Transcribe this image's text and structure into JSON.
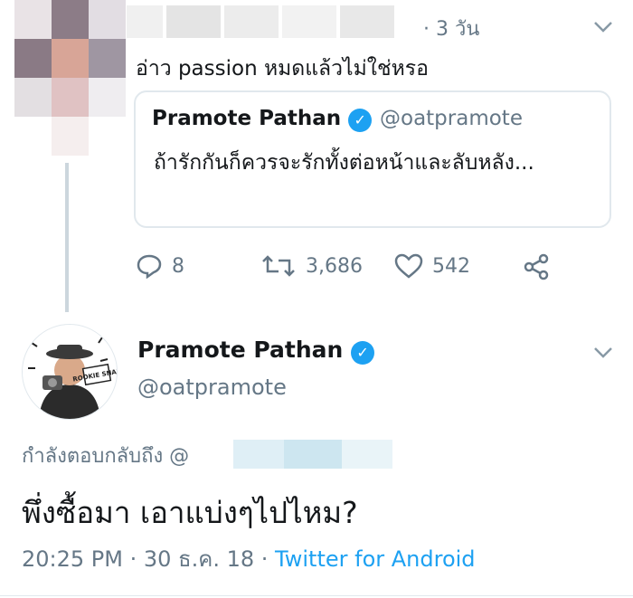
{
  "reply_tweet": {
    "time": "· 3 วัน",
    "text": "อ่าว passion หมดแล้วไม่ใช่หรอ",
    "actions": {
      "replies": "8",
      "retweets": "3,686",
      "likes": "542"
    }
  },
  "quoted_tweet": {
    "name": "Pramote Pathan",
    "handle": "@oatpramote",
    "text": "ถ้ารักกันก็ควรจะรักทั้งต่อหน้าและลับหลัง..."
  },
  "main_tweet": {
    "name": "Pramote Pathan",
    "handle": "@oatpramote",
    "avatar_text": "ROOKIE SNAP",
    "reply_prefix": "กำลังตอบกลับถึง @",
    "text": "พึ่งซื้อมา เอาแบ่งๆไปไหม?",
    "timestamp": "20:25 PM · 30 ธ.ค. 18 · ",
    "source": "Twitter for Android"
  },
  "colors": {
    "accent": "#1da1f2",
    "muted": "#657786",
    "border": "#e1e8ed"
  }
}
